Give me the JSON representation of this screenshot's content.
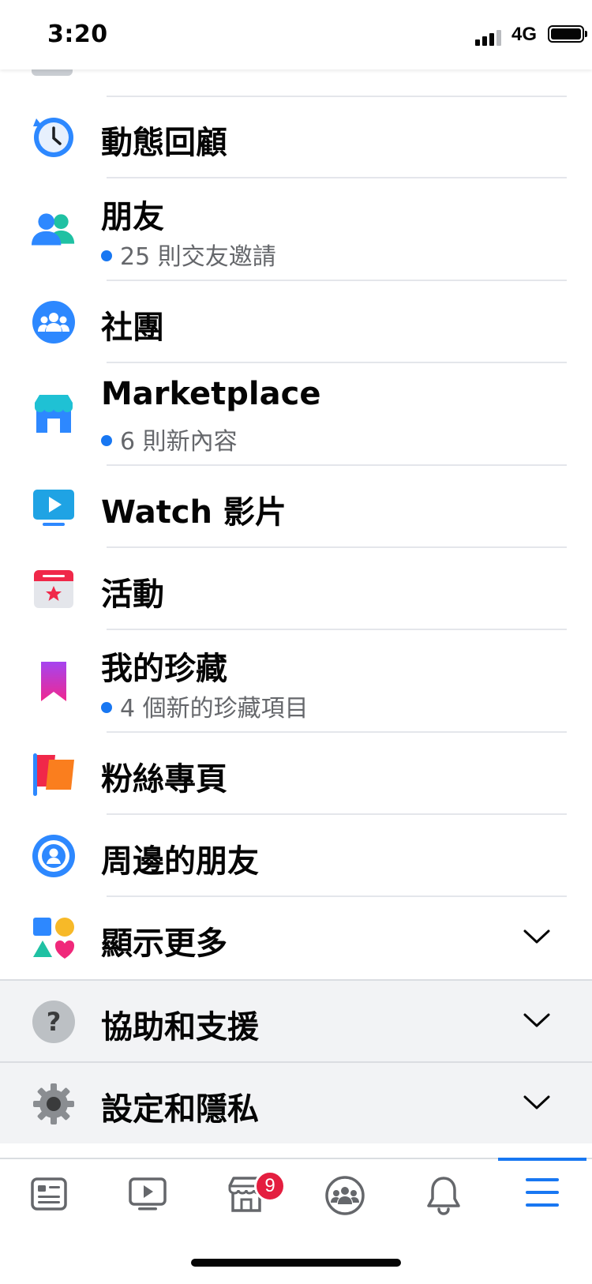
{
  "status_bar": {
    "time": "3:20",
    "network": "4G"
  },
  "menu": {
    "items": [
      {
        "label": "動態回顧",
        "icon": "memories-clock-icon"
      },
      {
        "label": "朋友",
        "subtitle": "25 則交友邀請",
        "icon": "friends-icon"
      },
      {
        "label": "社團",
        "icon": "groups-icon"
      },
      {
        "label": "Marketplace",
        "subtitle": "6 則新內容",
        "icon": "marketplace-store-icon"
      },
      {
        "label": "Watch 影片",
        "icon": "watch-video-icon"
      },
      {
        "label": "活動",
        "icon": "events-calendar-icon"
      },
      {
        "label": "我的珍藏",
        "subtitle": "4 個新的珍藏項目",
        "icon": "saved-bookmark-icon"
      },
      {
        "label": "粉絲專頁",
        "icon": "pages-flag-icon"
      },
      {
        "label": "周邊的朋友",
        "icon": "nearby-friends-icon"
      },
      {
        "label": "顯示更多",
        "icon": "see-more-shapes-icon"
      }
    ],
    "sections": [
      {
        "label": "協助和支援",
        "icon": "help-question-icon"
      },
      {
        "label": "設定和隱私",
        "icon": "settings-gear-icon"
      }
    ]
  },
  "tabbar": {
    "tabs": [
      {
        "name": "news-feed",
        "icon": "news-feed-icon"
      },
      {
        "name": "watch",
        "icon": "watch-tab-icon"
      },
      {
        "name": "marketplace",
        "icon": "marketplace-tab-icon",
        "badge": "9"
      },
      {
        "name": "groups",
        "icon": "groups-tab-icon"
      },
      {
        "name": "notifications",
        "icon": "bell-icon"
      },
      {
        "name": "menu",
        "icon": "hamburger-menu-icon",
        "active": true
      }
    ]
  },
  "colors": {
    "accent": "#1877f2",
    "badge": "#e41e3f",
    "secondary_text": "#65676b"
  }
}
